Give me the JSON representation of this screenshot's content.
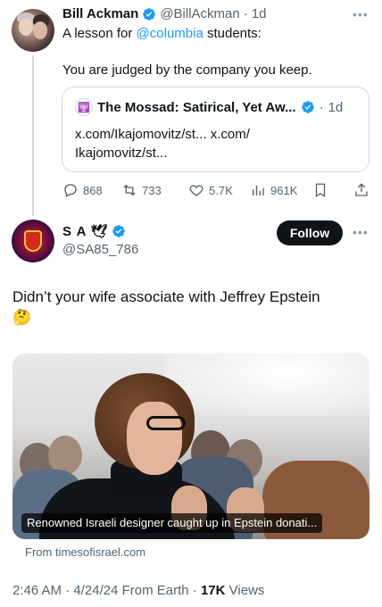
{
  "parent": {
    "name": "Bill Ackman",
    "handle": "@BillAckman",
    "sep": "·",
    "time": "1d",
    "line1_prefix": "A lesson for ",
    "line1_mention": "@columbia",
    "line1_suffix": " students:",
    "line2": "You are judged by the company you keep.",
    "quote": {
      "name": "The Mossad: Satirical, Yet Aw...",
      "time": "1d",
      "text": "x.com/Ikajomovitz/st... x.com/ Ikajomovitz/st..."
    },
    "actions": {
      "replies": "868",
      "reposts": "733",
      "likes": "5.7K",
      "views": "961K"
    }
  },
  "reply": {
    "name": "S A",
    "handle": "@SA85_786",
    "follow_label": "Follow",
    "text": "Didn’t your wife associate with Jeffrey Epstein",
    "emoji": "🤔",
    "media_caption": "Renowned Israeli designer caught up in Epstein donati...",
    "source": "From timesofisrael.com",
    "time": "2:46 AM",
    "date": "4/24/24",
    "client": "From Earth",
    "views": "17K",
    "views_label": "Views"
  },
  "colors": {
    "accent": "#1d9bf0",
    "text": "#0f1419",
    "muted": "#536471",
    "border": "#cfd9de"
  }
}
